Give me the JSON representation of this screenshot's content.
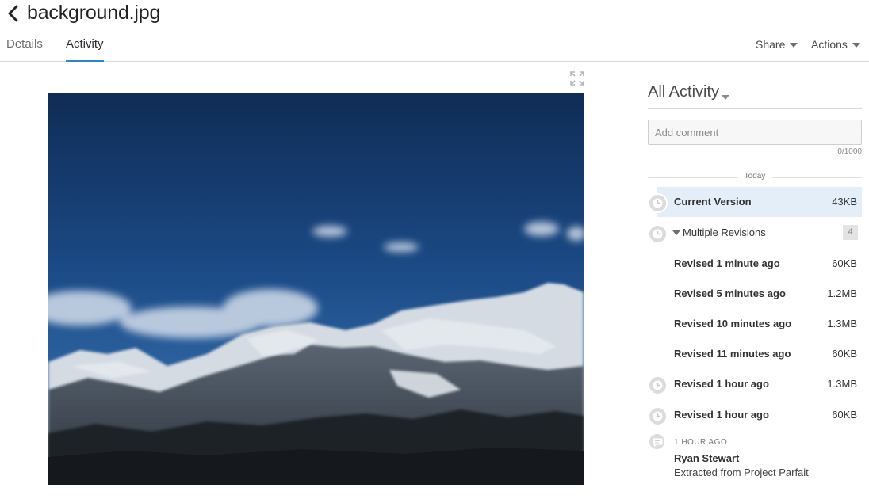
{
  "file": {
    "title": "background.jpg"
  },
  "tabs": [
    {
      "label": "Details",
      "active": false
    },
    {
      "label": "Activity",
      "active": true
    }
  ],
  "header_menus": {
    "share": "Share",
    "actions": "Actions"
  },
  "activity": {
    "filter_label": "All Activity",
    "comment_placeholder": "Add comment",
    "comment_counter": "0/1000",
    "day_label": "Today",
    "current": {
      "label": "Current Version",
      "size": "43KB"
    },
    "multiple": {
      "label": "Multiple Revisions",
      "count": "4"
    },
    "revisions": [
      {
        "label": "Revised 1 minute ago",
        "size": "60KB"
      },
      {
        "label": "Revised 5 minutes ago",
        "size": "1.2MB"
      },
      {
        "label": "Revised 10 minutes ago",
        "size": "1.3MB"
      },
      {
        "label": "Revised 11 minutes ago",
        "size": "60KB"
      }
    ],
    "older": [
      {
        "label": "Revised 1 hour ago",
        "size": "1.3MB"
      },
      {
        "label": "Revised 1 hour ago",
        "size": "60KB"
      }
    ],
    "comment": {
      "time": "1 HOUR AGO",
      "user": "Ryan Stewart",
      "text": "Extracted from Project Parfait"
    }
  },
  "colors": {
    "accent": "#2d83d6",
    "current_bg": "#e3eef8"
  },
  "icons": {
    "back": "chevron-left-icon",
    "expand": "fullscreen-icon",
    "version": "clock-icon",
    "comment": "speech-bubble-icon"
  }
}
